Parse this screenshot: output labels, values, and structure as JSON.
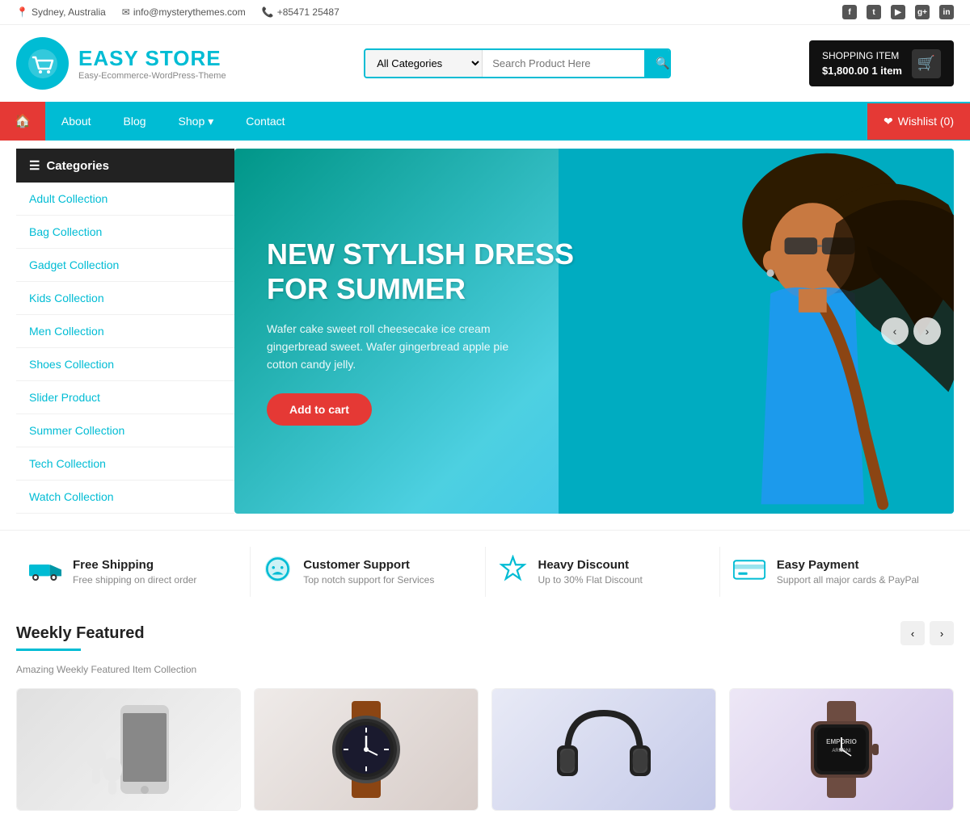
{
  "topbar": {
    "location": "Sydney, Australia",
    "email": "info@mysterythemes.com",
    "phone": "+85471 25487",
    "socials": [
      "f",
      "t",
      "y",
      "g+",
      "in"
    ]
  },
  "header": {
    "logo_title": "EASY STORE",
    "logo_sub": "Easy-Ecommerce-WordPress-Theme",
    "search_placeholder": "Search Product Here",
    "search_category": "All Categories",
    "cart_label": "SHOPPING ITEM",
    "cart_price": "$1,800.00",
    "cart_items": "1 item"
  },
  "nav": {
    "home_icon": "🏠",
    "items": [
      "About",
      "Blog",
      "Shop",
      "Contact"
    ],
    "shop_has_dropdown": true,
    "wishlist_label": "Wishlist (0)"
  },
  "sidebar": {
    "header": "Categories",
    "items": [
      "Adult Collection",
      "Bag Collection",
      "Gadget Collection",
      "Kids Collection",
      "Men Collection",
      "Shoes Collection",
      "Slider Product",
      "Summer Collection",
      "Tech Collection",
      "Watch Collection"
    ]
  },
  "slider": {
    "title_line1": "NEW STYLISH DRESS",
    "title_line2": "FOR SUMMER",
    "description": "Wafer cake sweet roll cheesecake ice cream gingerbread sweet. Wafer gingerbread apple pie cotton candy jelly.",
    "button_label": "Add to cart",
    "prev_label": "‹",
    "next_label": "›"
  },
  "features": [
    {
      "icon": "🚚",
      "title": "Free Shipping",
      "desc": "Free shipping on direct order"
    },
    {
      "icon": "💬",
      "title": "Customer Support",
      "desc": "Top notch support for Services"
    },
    {
      "icon": "⭐",
      "title": "Heavy Discount",
      "desc": "Up to 30% Flat Discount"
    },
    {
      "icon": "💳",
      "title": "Easy Payment",
      "desc": "Support all major cards & PayPal"
    }
  ],
  "weekly": {
    "title": "Weekly Featured",
    "subtitle": "Amazing Weekly Featured Item Collection",
    "prev_label": "‹",
    "next_label": "›",
    "products": [
      {
        "type": "phone",
        "alt": "Phone and earbuds"
      },
      {
        "type": "watch1",
        "alt": "Classic watch"
      },
      {
        "type": "headphones",
        "alt": "Headphones"
      },
      {
        "type": "watch2",
        "alt": "Luxury watch"
      }
    ]
  },
  "colors": {
    "primary": "#00bcd4",
    "accent": "#e53935",
    "dark": "#222222",
    "text_muted": "#888888"
  }
}
